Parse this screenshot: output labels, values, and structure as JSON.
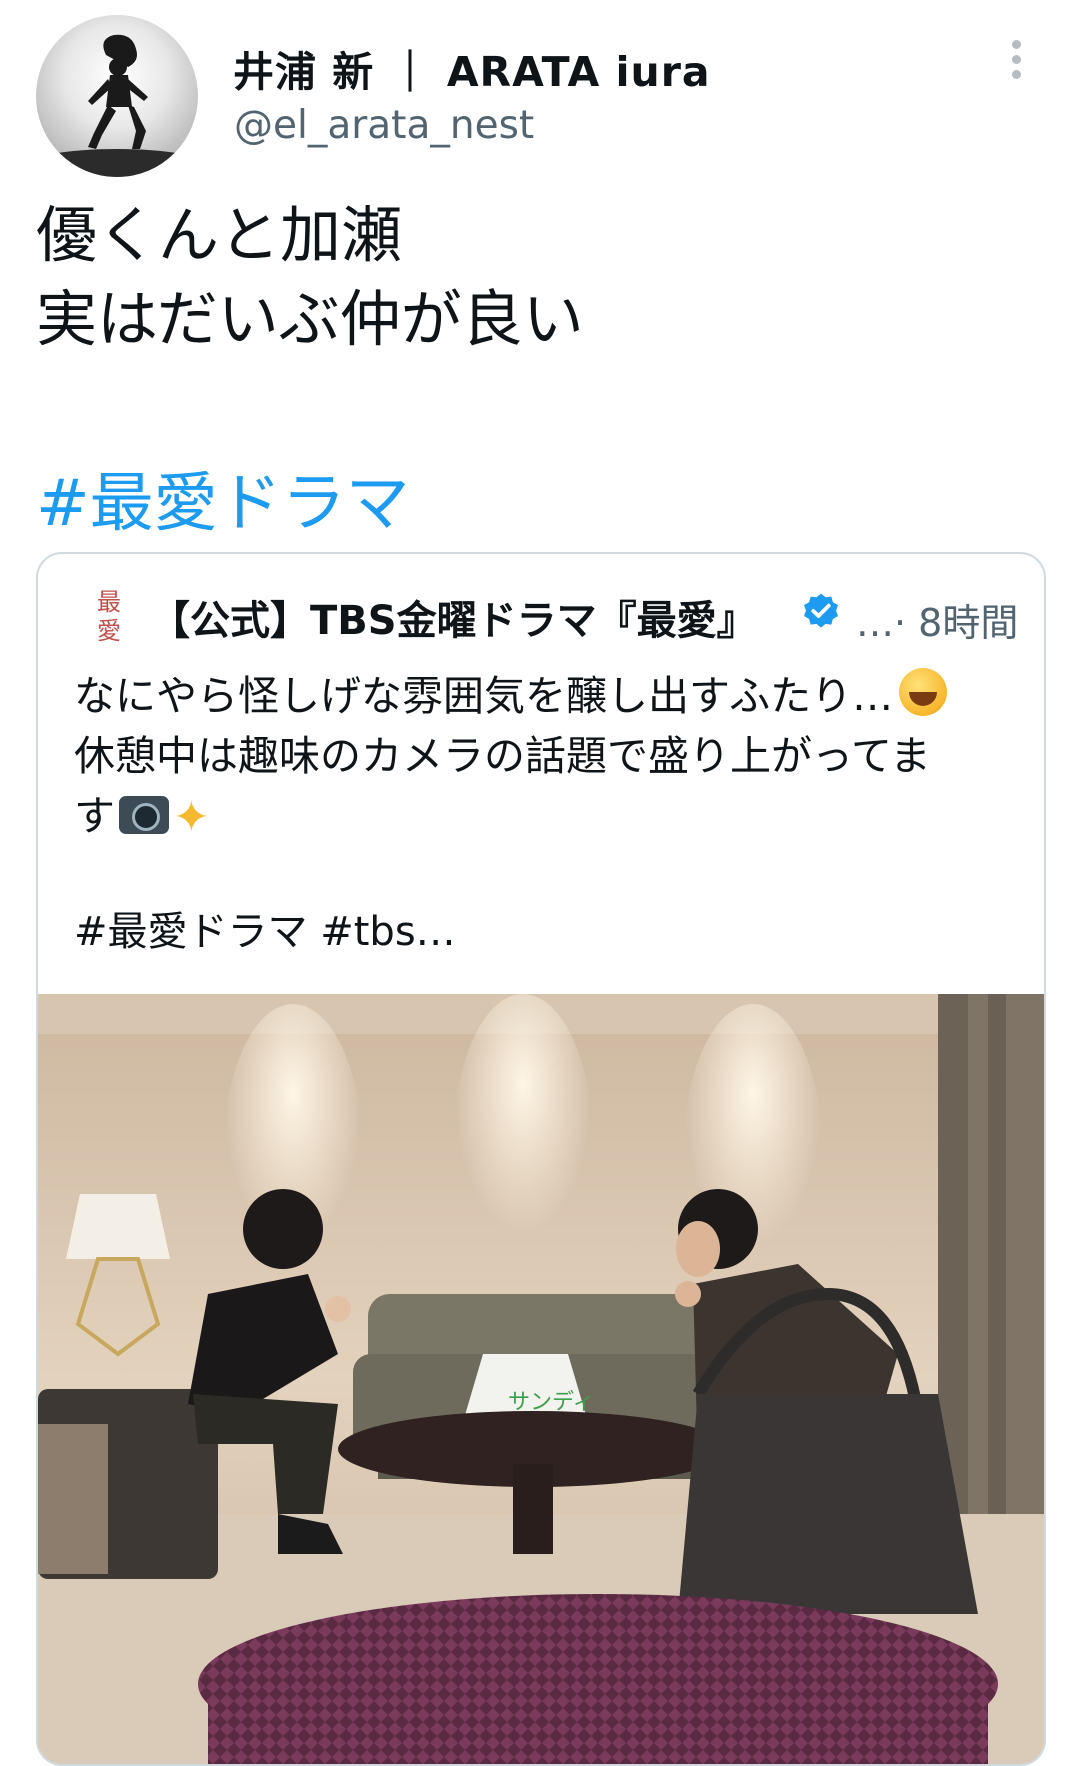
{
  "author": {
    "display_name": "井浦 新 ｜ ARATA iura",
    "handle": "@el_arata_nest"
  },
  "tweet": {
    "lines": [
      "優くんと加瀬",
      "実はだいぶ仲が良い"
    ],
    "hashtag": "#最愛ドラマ"
  },
  "quoted": {
    "avatar_text": "最\n愛",
    "name": "【公式】TBS金曜ドラマ『最愛』",
    "meta": "…· 8時間",
    "line1": "なにやら怪しげな雰囲気を醸し出すふたり…",
    "line2": "休憩中は趣味のカメラの話題で盛り上がってま",
    "line3": "す",
    "hashtags": "#最愛ドラマ #tbs…",
    "photo_bag_text": "サンディ"
  },
  "icons": {
    "more": "more-vertical-icon",
    "verified": "verified-badge-icon",
    "emoji_laugh": "grinning-squinting-face-emoji",
    "emoji_camera": "camera-emoji",
    "emoji_sparkles": "sparkles-emoji"
  },
  "colors": {
    "link": "#1d9bf0",
    "verified": "#1d9bf0",
    "secondary_text": "#536471",
    "card_border": "#cfd9de"
  }
}
